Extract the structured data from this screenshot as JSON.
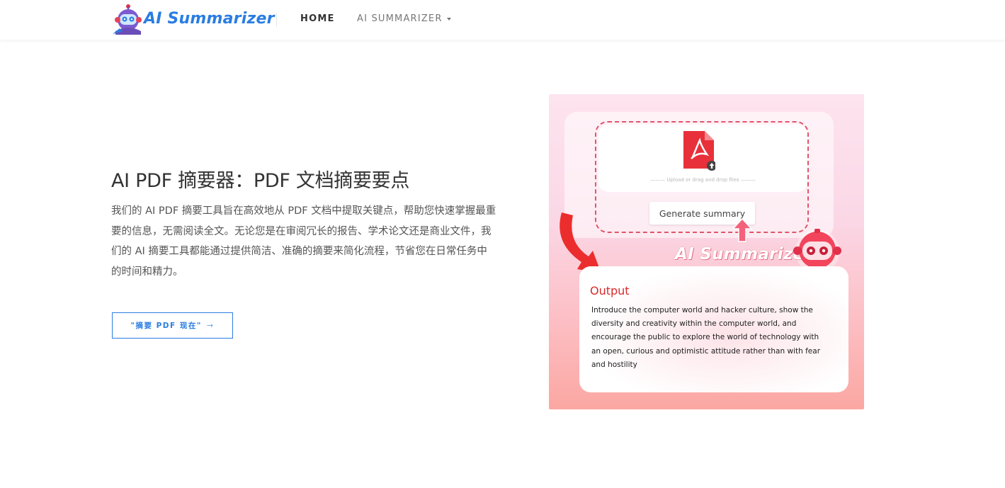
{
  "header": {
    "logo_text": "AI Summarizer",
    "nav": [
      {
        "label": "HOME"
      },
      {
        "label": "AI SUMMARIZER"
      }
    ]
  },
  "hero": {
    "title": "AI PDF 摘要器：PDF 文档摘要要点",
    "description": "我们的 AI PDF 摘要工具旨在高效地从 PDF 文档中提取关键点，帮助您快速掌握最重要的信息，无需阅读全文。无论您是在审阅冗长的报告、学术论文还是商业文件，我们的 AI 摘要工具都能通过提供简洁、准确的摘要来简化流程，节省您在日常任务中的时间和精力。",
    "cta_label": "\"摘要 PDF 现在\"",
    "cta_arrow": "→"
  },
  "illustration": {
    "upload_hint": "——— Upload or drag and drop files ———",
    "generate_label": "Generate summary",
    "brand_text": "AI Summarizer",
    "output_title": "Output",
    "output_text": "Introduce the computer world and hacker culture, show the diversity and creativity within the computer world, and encourage the public to explore the world of technology with an open, curious and optimistic attitude rather than with fear and hostility"
  },
  "colors": {
    "accent": "#2a7de1",
    "pdf_red": "#e8303a",
    "output_red": "#d92a2a"
  },
  "icons": {
    "logo_mark": "robot-mascot-icon",
    "nav_caret": "caret-down-icon",
    "pdf": "pdf-file-icon",
    "upload": "upload-arrow-icon",
    "cta_arrow": "arrow-right-icon"
  }
}
